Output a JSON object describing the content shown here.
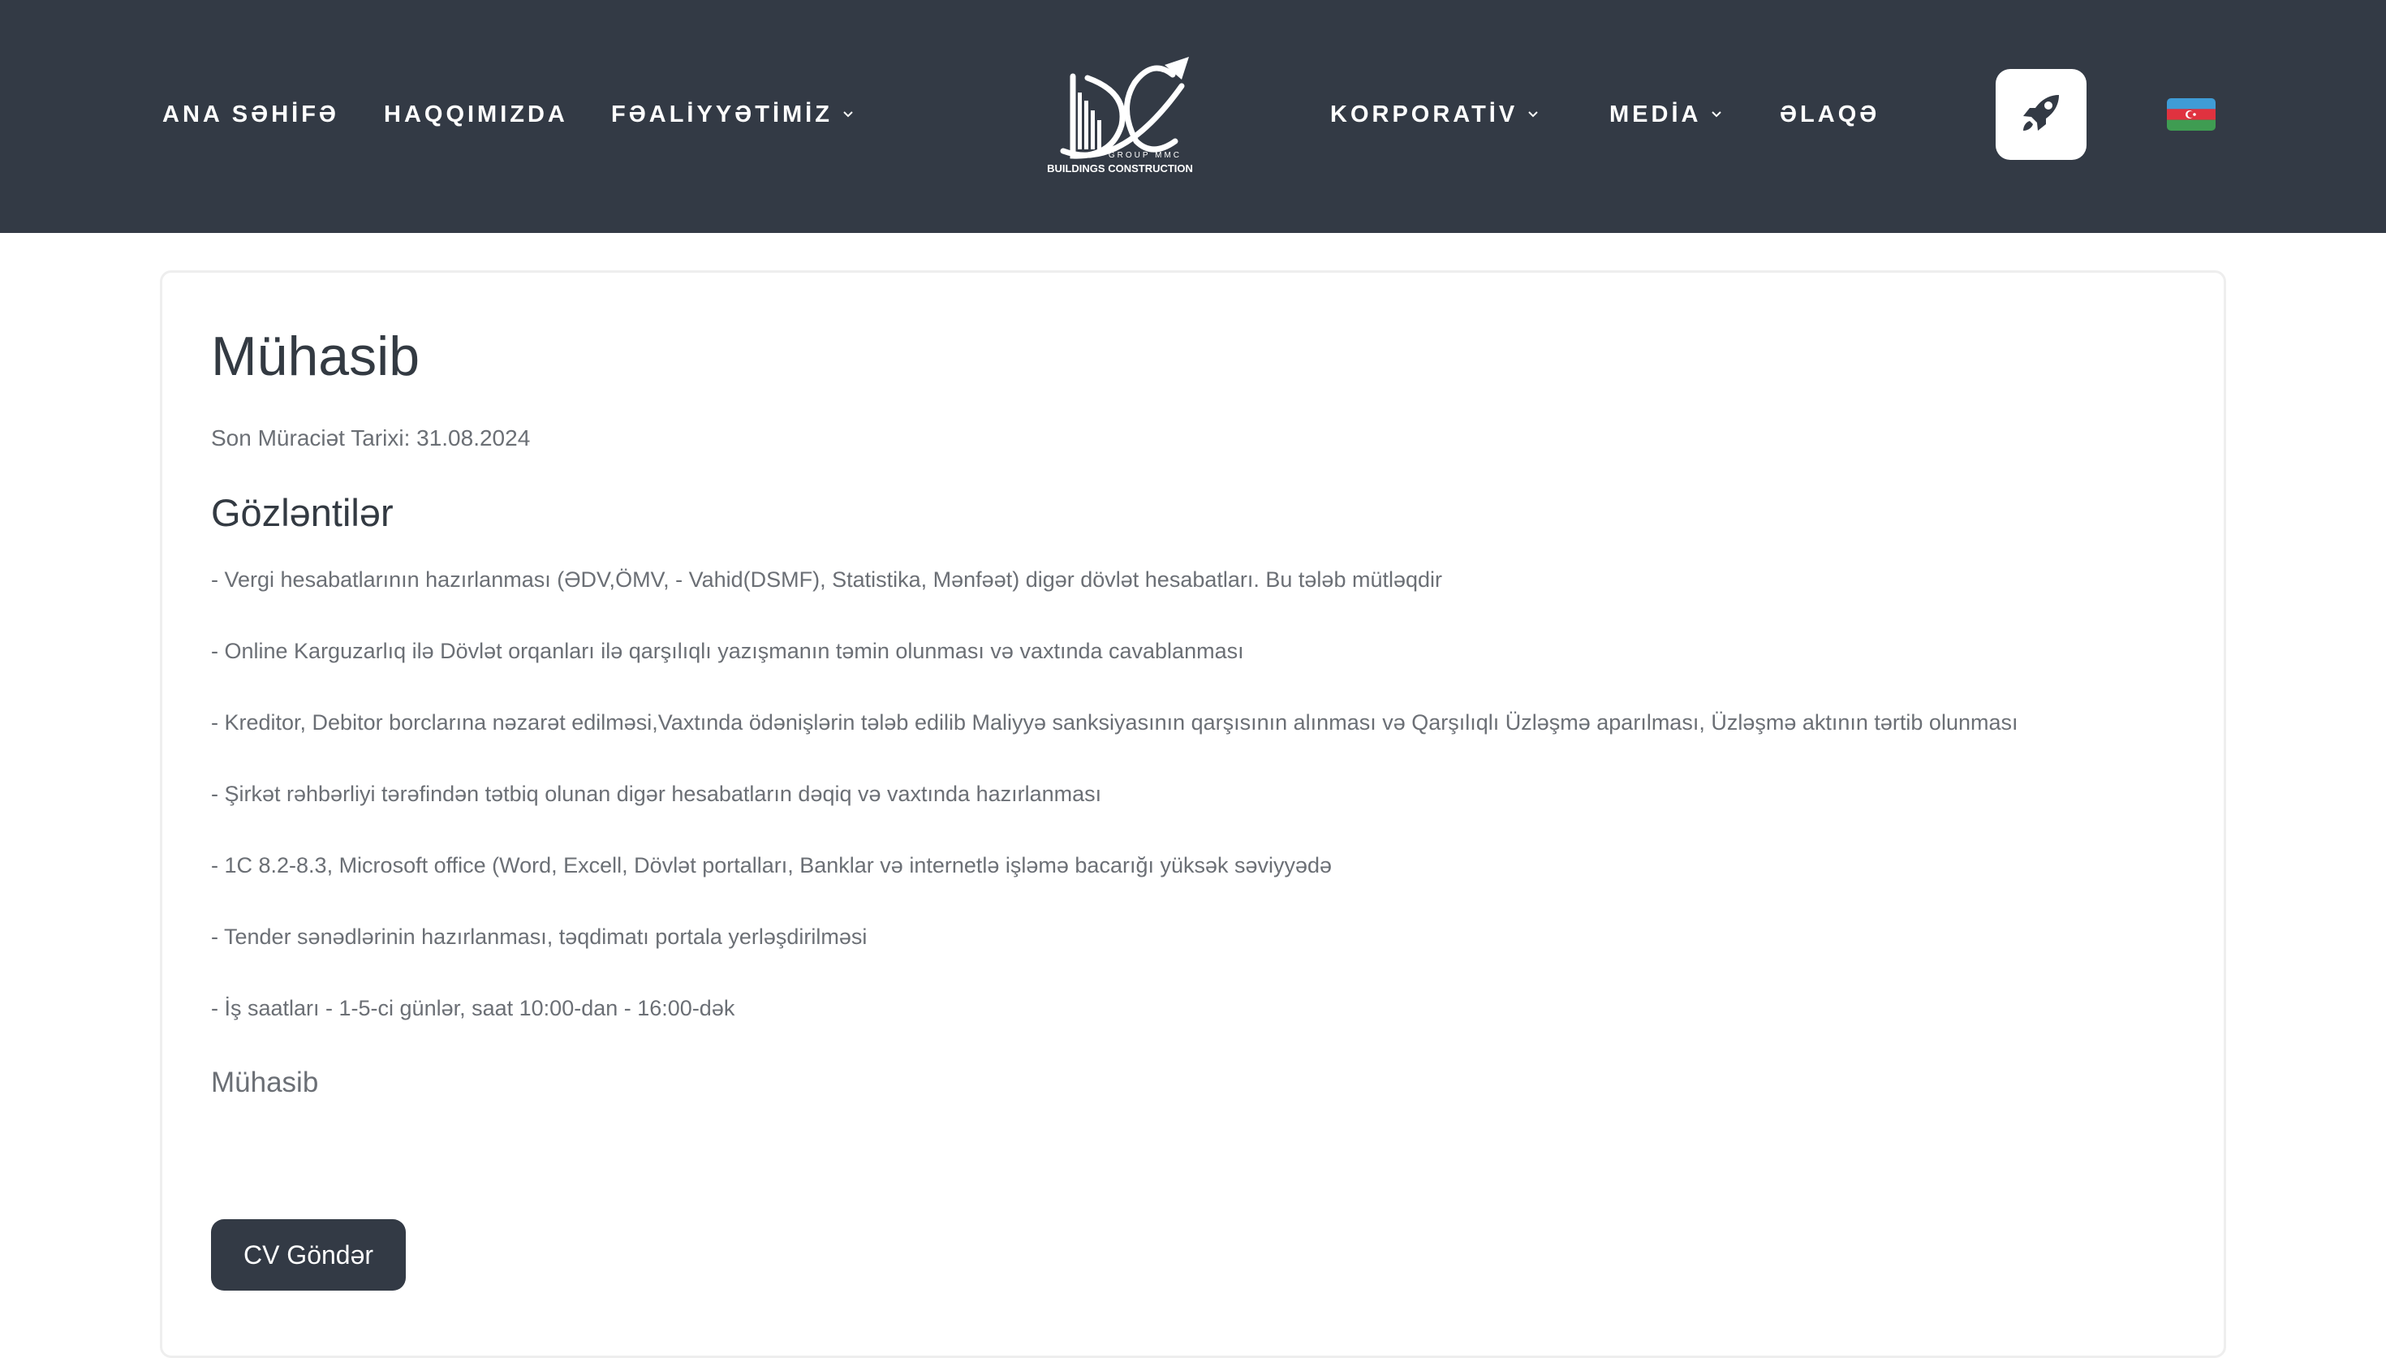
{
  "nav": {
    "home": "ANA SƏHİFƏ",
    "about": "HAQQIMIZDA",
    "activities": "FƏALİYYƏTİMİZ",
    "corporate": "KORPORATİV",
    "media": "MEDİA",
    "contact": "ƏLAQƏ"
  },
  "logo": {
    "subtext": "GROUP MMC",
    "caption": "BUILDINGS CONSTRUCTION"
  },
  "icons": {
    "rocket": "rocket-icon",
    "chevron": "chevron-down-icon",
    "flag": "azerbaijan-flag-icon"
  },
  "colors": {
    "header_bg": "#333a45",
    "button_bg": "#333a45",
    "flag_blue": "#3f9cd6",
    "flag_red": "#e0323f",
    "flag_green": "#3f9c52"
  },
  "job": {
    "title": "Mühasib",
    "deadline": "Son Müraciət Tarixi: 31.08.2024",
    "section_title": "Gözləntilər",
    "requirements": [
      "- Vergi hesabatlarının hazırlanması (ƏDV,ÖMV, - Vahid(DSMF), Statistika, Mənfəət) digər dövlət hesabatları. Bu tələb mütləqdir",
      "- Online Karguzarlıq ilə Dövlət orqanları ilə qarşılıqlı yazışmanın təmin olunması və vaxtında cavablanması",
      "- Kreditor, Debitor borclarına nəzarət edilməsi,Vaxtında ödənişlərin tələb edilib Maliyyə sanksiyasının qarşısının alınması və Qarşılıqlı Üzləşmə aparılması, Üzləşmə aktının tərtib olunması",
      "- Şirkət rəhbərliyi tərəfindən tətbiq olunan digər hesabatların dəqiq və vaxtında hazırlanması",
      "- 1C 8.2-8.3, Microsoft office (Word, Excell, Dövlət portalları, Banklar və internetlə işləmə bacarığı yüksək səviyyədə",
      "- Tender sənədlərinin hazırlanması, təqdimatı portala yerləşdirilməsi",
      "- İş saatları - 1-5-ci günlər, saat 10:00-dan - 16:00-dək"
    ],
    "subtitle": "Mühasib",
    "cv_button": "CV Göndər"
  }
}
